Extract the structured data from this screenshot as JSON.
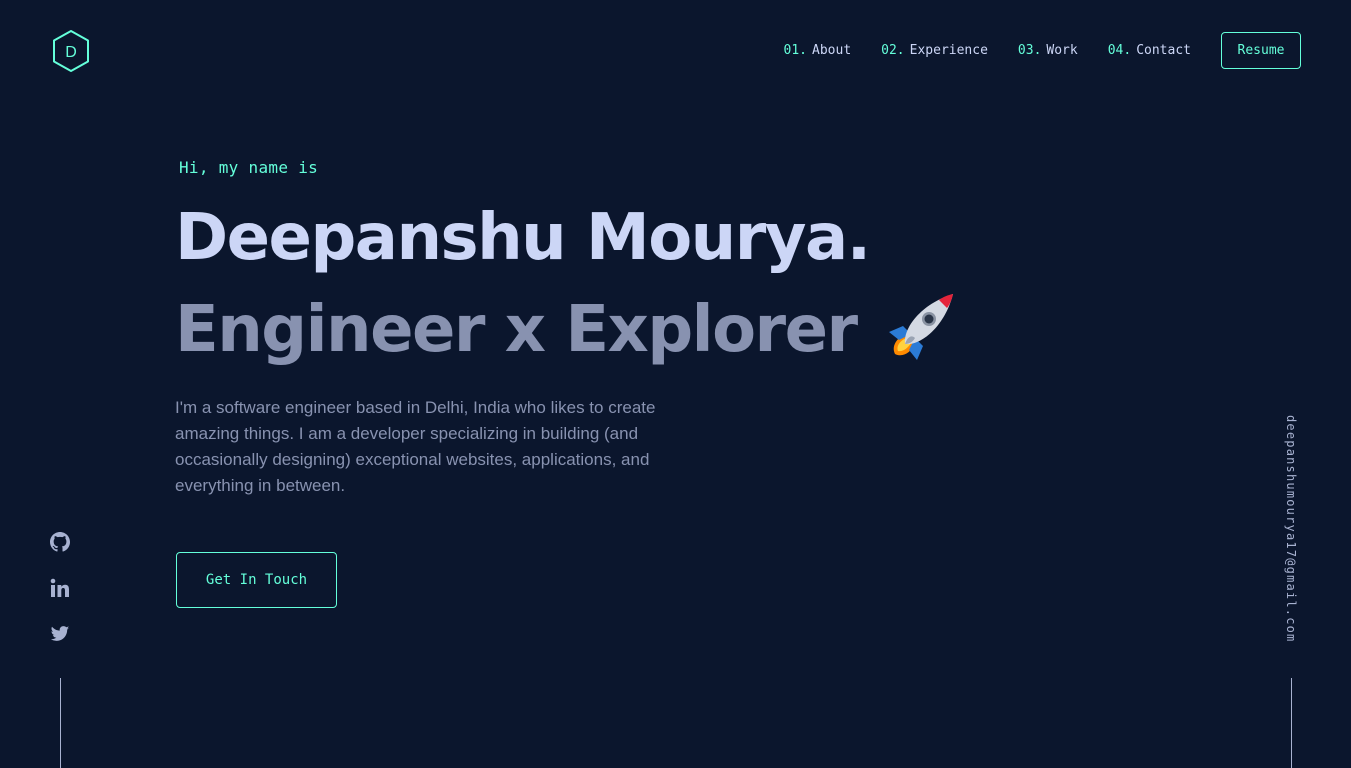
{
  "logo": {
    "letter": "D"
  },
  "nav": {
    "items": [
      {
        "num": "01.",
        "label": "About"
      },
      {
        "num": "02.",
        "label": "Experience"
      },
      {
        "num": "03.",
        "label": "Work"
      },
      {
        "num": "04.",
        "label": "Contact"
      }
    ],
    "resume_label": "Resume"
  },
  "hero": {
    "greeting": "Hi, my name is",
    "name": "Deepanshu Mourya.",
    "tagline": "Engineer x Explorer",
    "tagline_icon": "rocket-icon",
    "bio": "I'm a software engineer based in Delhi, India who likes to create amazing things. I am a developer specializing in building (and occasionally designing) exceptional websites, applications, and everything in between.",
    "cta_label": "Get In Touch"
  },
  "socials": {
    "icons": [
      "github-icon",
      "linkedin-icon",
      "twitter-icon"
    ]
  },
  "email": "deepanshumourya17@gmail.com",
  "colors": {
    "background": "#0b162d",
    "accent": "#64ffda",
    "heading": "#ccd6f6",
    "muted": "#8892b0",
    "light": "#a8b2d1"
  }
}
